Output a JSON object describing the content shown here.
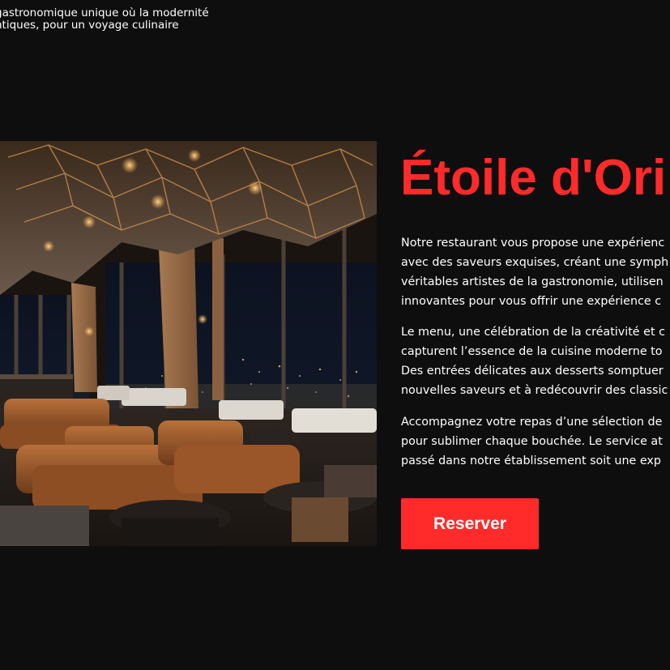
{
  "intro": {
    "line1": "gastronomique unique où la modernité",
    "line2": "ntiques, pour un voyage culinaire"
  },
  "hero": {
    "title": "Étoile d'Ori",
    "paragraphs": [
      [
        "Notre restaurant vous propose une expérienc",
        "avec des saveurs exquises, créant une symph",
        "véritables artistes de la gastronomie, utilisen",
        "innovantes pour vous offrir une expérience c"
      ],
      [
        "Le menu, une célébration de la créativité et c",
        "capturent l’essence de la cuisine moderne to",
        "Des entrées délicates aux desserts somptuer",
        "nouvelles saveurs et à redécouvrir des classic"
      ],
      [
        "Accompagnez votre repas d’une sélection de",
        "pour sublimer chaque bouchée. Le service at",
        "passé dans notre établissement soit une exp"
      ]
    ],
    "cta_label": "Reserver"
  },
  "colors": {
    "background": "#0e0e0f",
    "accent": "#ff2a2a",
    "text": "#ffffff"
  }
}
